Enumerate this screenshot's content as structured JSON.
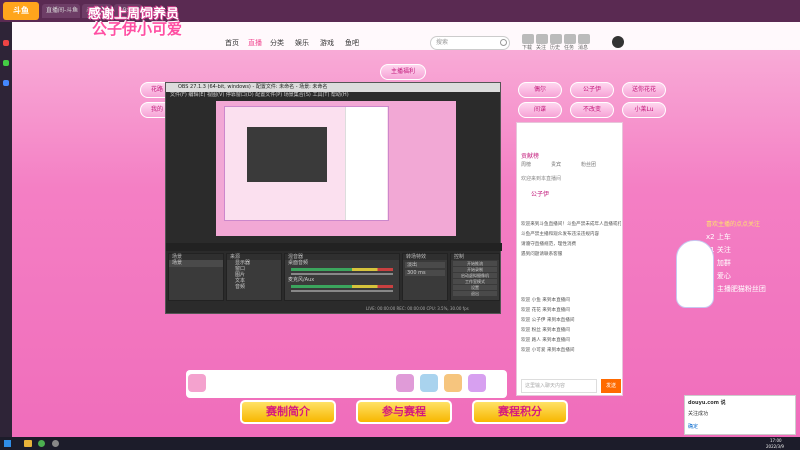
{
  "browser": {
    "tabs": [
      "直播间-斗鱼",
      "斗鱼",
      "OBS",
      "公子伊-斗鱼直播",
      "管理员",
      "设置"
    ],
    "logo_text": "斗鱼"
  },
  "header": {
    "marquee_line1": "感谢上周饲养员",
    "marquee_line2": "公子伊小可爱",
    "nav": [
      "首页",
      "直播",
      "分类",
      "娱乐",
      "游戏",
      "鱼吧"
    ],
    "search_placeholder": "搜索",
    "icons": [
      "下载",
      "关注",
      "历史",
      "任务",
      "消息"
    ]
  },
  "page": {
    "anchor_pill": "主播福利",
    "pills_left": [
      "花路",
      "我的"
    ],
    "pills_right": [
      "偶尔",
      "公子伊",
      "送你花花",
      "间谍",
      "不改变",
      "小莱Lu"
    ],
    "stream_hint": "直播中"
  },
  "obs": {
    "title": "OBS 27.1.3 (64-bit, windows) - 配置文件: 未命名 - 场景: 未命名",
    "menu": "文件(F) 编辑(E) 视图(V) 停靠窗口(D) 配置文件(P) 场景集合(S) 工具(T) 帮助(H)",
    "docks": [
      "场景",
      "来源",
      "混音器",
      "转场特效",
      "控制"
    ],
    "scene_name": "场景",
    "sources": [
      "显示器",
      "窗口",
      "图片",
      "文本",
      "音频"
    ],
    "mixer": [
      "桌面音频",
      "麦克风/Aux"
    ],
    "transition": "淡出",
    "duration": "300 ms",
    "controls": [
      "开始推流",
      "开始录制",
      "启动虚拟摄像机",
      "工作室模式",
      "设置",
      "退出"
    ],
    "status": "LIVE: 00:00:00  REC: 00:00:00  CPU: 3.5%, 30.00 fps"
  },
  "side_panel": {
    "ranking_title": "贡献榜",
    "tabs": [
      "周榜",
      "贵宾",
      "粉丝团"
    ],
    "notice": "欢迎来到本直播间",
    "host_name": "公子伊",
    "chat": [
      "欢迎来到斗鱼直播间！斗鱼严禁未成年人直播或打赏",
      "斗鱼严禁主播和观众发布违法违规内容",
      "请遵守直播规范，理性消费",
      "遇到问题请联系客服",
      "欢迎 小鱼 来到本直播间",
      "欢迎 花花 来到本直播间",
      "欢迎 公子伊 来到本直播间",
      "欢迎 粉丝 来到本直播间",
      "欢迎 路人 来到本直播间",
      "欢迎 小可爱 来到本直播间"
    ],
    "input_placeholder": "这里输入聊天内容",
    "send_label": "发送"
  },
  "bottom": {
    "buttons": [
      "赛制简介",
      "参与赛程",
      "赛程积分"
    ],
    "gifts": [
      "荧光棒",
      "办卡",
      "飞机",
      "火箭",
      "超火"
    ]
  },
  "fans": {
    "title": "喜欢主播的点点关注",
    "lines": [
      "x2 上车",
      "x1 关注",
      "x1 加群",
      "x1 爱心",
      "x0 主播肥猫粉丝团"
    ]
  },
  "toast": {
    "title": "douyu.com 说",
    "line1": "关注成功",
    "line2": "确定"
  },
  "taskbar": {
    "time": "17:00",
    "date": "2022/3/9"
  },
  "colors": {
    "accent": "#f06dbb",
    "brand": "#ffa51c",
    "button_gold": "#f7b600"
  }
}
